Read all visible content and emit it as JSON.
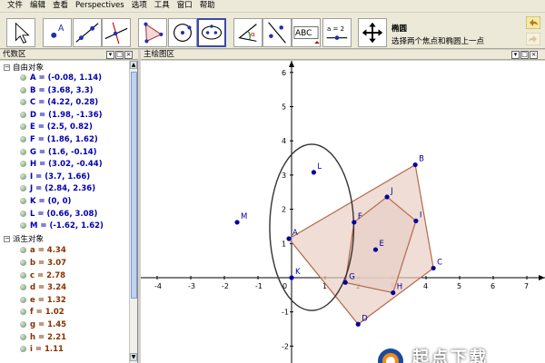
{
  "menu": [
    "文件",
    "编辑",
    "查看",
    "Perspectives",
    "选项",
    "工具",
    "窗口",
    "帮助"
  ],
  "tool_info": {
    "title": "椭圆",
    "description": "选择两个焦点和椭圆上一点"
  },
  "toolbar": {
    "tools": [
      "move-tool",
      "point-tool",
      "line-tool",
      "perpendicular-line-tool",
      "polygon-tool",
      "circle-tool",
      "ellipse-tool",
      "angle-tool",
      "reflect-tool",
      "text-tool",
      "slider-tool",
      "move-graphics-tool"
    ],
    "text_tool_label": "ABC",
    "slider_tool_label": "a = 2"
  },
  "algebra": {
    "title": "代数区",
    "free_title": "自由对象",
    "dependent_title": "派生对象",
    "free": [
      "A = (-0.08, 1.14)",
      "B = (3.68, 3.3)",
      "C = (4.22, 0.28)",
      "D = (1.98, -1.36)",
      "E = (2.5, 0.82)",
      "F = (1.86, 1.62)",
      "G = (1.6, -0.14)",
      "H = (3.02, -0.44)",
      "I = (3.7, 1.66)",
      "J = (2.84, 2.36)",
      "K = (0, 0)",
      "L = (0.66, 3.08)",
      "M = (-1.62, 1.62)"
    ],
    "dependent": [
      "a = 4.34",
      "b = 3.07",
      "c = 2.78",
      "d = 3.24",
      "e = 1.32",
      "f = 1.02",
      "g = 1.45",
      "h = 2.21",
      "i = 1.11"
    ]
  },
  "graphics": {
    "title": "主绘图区",
    "x_ticks": [
      "-4",
      "-3",
      "-2",
      "-1",
      "0",
      "1",
      "2",
      "3",
      "4",
      "5",
      "6",
      "7"
    ],
    "y_ticks": [
      "-2",
      "-1",
      "1",
      "2",
      "3",
      "4",
      "5",
      "6"
    ],
    "points": [
      {
        "name": "A",
        "x": -0.08,
        "y": 1.14
      },
      {
        "name": "B",
        "x": 3.68,
        "y": 3.3
      },
      {
        "name": "C",
        "x": 4.22,
        "y": 0.28
      },
      {
        "name": "D",
        "x": 1.98,
        "y": -1.36
      },
      {
        "name": "E",
        "x": 2.5,
        "y": 0.82
      },
      {
        "name": "F",
        "x": 1.86,
        "y": 1.62
      },
      {
        "name": "G",
        "x": 1.6,
        "y": -0.14
      },
      {
        "name": "H",
        "x": 3.02,
        "y": -0.44
      },
      {
        "name": "I",
        "x": 3.7,
        "y": 1.66
      },
      {
        "name": "J",
        "x": 2.84,
        "y": 2.36
      },
      {
        "name": "K",
        "x": 0,
        "y": 0
      },
      {
        "name": "L",
        "x": 0.66,
        "y": 3.08
      },
      {
        "name": "M",
        "x": -1.62,
        "y": 1.62
      }
    ],
    "polygons": [
      [
        "A",
        "B",
        "C",
        "D"
      ],
      [
        "F",
        "J",
        "I",
        "H",
        "G"
      ]
    ],
    "ellipse": {
      "cx": 0.6,
      "cy": 1.47,
      "rx": 1.25,
      "ry": 2.43
    },
    "colors": {
      "polygon_fill": "#e8cfc4",
      "polygon_stroke": "#b46a4a",
      "point": "#0000a0",
      "ellipse": "#333333"
    }
  },
  "watermark": "起点下载"
}
